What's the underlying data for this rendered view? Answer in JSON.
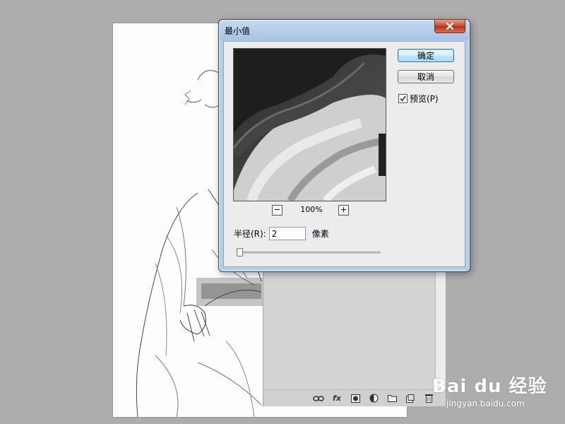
{
  "dialog": {
    "title": "最小值",
    "ok_label": "确定",
    "cancel_label": "取消",
    "preview_label": "预览(P)",
    "preview_checked": true,
    "zoom_out_label": "−",
    "zoom_in_label": "+",
    "zoom_level": "100%",
    "radius_label": "半径(R):",
    "radius_value": "2",
    "radius_unit": "像素",
    "slider_value": 2
  },
  "layers_panel": {
    "toolbar_icons": [
      "link-icon",
      "fx-icon",
      "layer-mask-icon",
      "adjustment-layer-icon",
      "folder-icon",
      "new-layer-icon",
      "trash-icon"
    ],
    "fx_label": "fx"
  },
  "watermark": {
    "brand": "Bai du 经验",
    "url": "jingyan.baidu.com"
  },
  "colors": {
    "desktop": "#adadad",
    "dialog_frame": "#b7cee8",
    "dialog_body": "#ececec",
    "close_button": "#c8452e",
    "ok_button": "#bee6fd"
  }
}
